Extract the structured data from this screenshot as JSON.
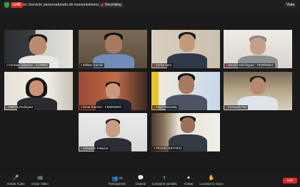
{
  "header": {
    "live_badge": "LIVE",
    "stream_title": "en Servicio personalizado de transmisión en vivo",
    "recording_label": "Recording",
    "view_label": "Vista"
  },
  "participants": [
    {
      "name": "Christian Sánchez - CLODEC",
      "muted": true,
      "active": true
    },
    {
      "name": "William Garzón",
      "muted": true
    },
    {
      "name": "Carlos Vera",
      "muted": true
    },
    {
      "name": "Honorio Domínguez - FEDENNES",
      "muted": true
    },
    {
      "name": "Patricia Rodríguez",
      "muted": true
    },
    {
      "name": "Omar Ramírez - FEDENNES",
      "muted": true
    },
    {
      "name": "Angel Simoneta",
      "muted": true
    },
    {
      "name": "Fernando Paz",
      "muted": true
    },
    {
      "name": "Sebastián Palacios",
      "muted": true
    },
    {
      "name": "PROSECRETARIO",
      "muted": true
    }
  ],
  "toolbar": {
    "unmute_label": "Activar Audio",
    "video_label": "Iniciar Video",
    "participants_label": "Participantes",
    "participants_count": "25",
    "chat_label": "Chatear",
    "share_label": "Compartir pantalla",
    "record_label": "Grabar",
    "raise_hand_label": "Levantar la mano",
    "leave_label": "Salir"
  },
  "colors": {
    "live": "#e02828",
    "active_speaker": "#d7df23",
    "share": "#2ea043",
    "leave": "#e02828"
  }
}
